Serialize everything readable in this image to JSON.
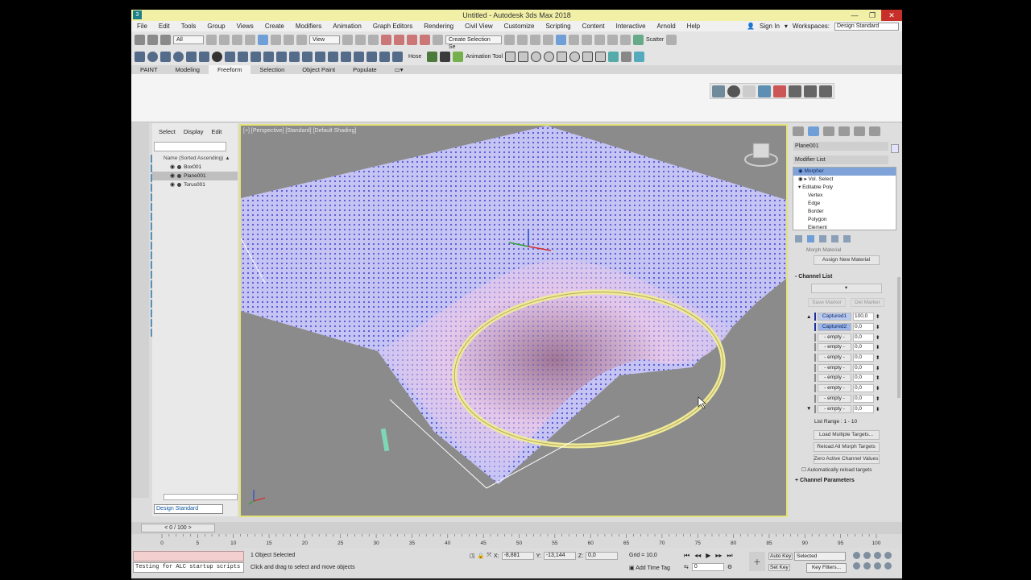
{
  "window": {
    "title": "Untitled - Autodesk 3ds Max 2018",
    "logo": "3",
    "minimize": "—",
    "maximize": "❐",
    "close": "✕"
  },
  "menu": {
    "items": [
      "File",
      "Edit",
      "Tools",
      "Group",
      "Views",
      "Create",
      "Modifiers",
      "Animation",
      "Graph Editors",
      "Rendering",
      "Civil View",
      "Customize",
      "Scripting",
      "Content",
      "Interactive",
      "Arnold",
      "Help"
    ],
    "sign_in": "Sign In",
    "workspaces_label": "Workspaces:",
    "workspace_value": "Design Standard"
  },
  "toolbar1": {
    "filter_value": "All",
    "view_value": "View",
    "selection_set": "Create Selection Se",
    "scatter": "Scatter"
  },
  "toolbar2": {
    "hose": "Hose",
    "animation_tool": "Animation Tool"
  },
  "ribbon_tabs": [
    "PAINT",
    "Modeling",
    "Freeform",
    "Selection",
    "Object Paint",
    "Populate"
  ],
  "ribbon_active": "Freeform",
  "scene_explorer": {
    "tabs": [
      "Select",
      "Display",
      "Edit"
    ],
    "column_header": "Name (Sorted Ascending)",
    "objects": [
      "Box001",
      "Plane001",
      "Torus001"
    ],
    "selected": "Plane001",
    "workspace": "Design Standard"
  },
  "viewport": {
    "label": "[+] [Perspective] [Standard] [Default Shading]"
  },
  "command_panel": {
    "object_name": "Plane001",
    "modifier_list_label": "Modifier List",
    "stack": {
      "morpher": "Morpher",
      "vol_select": "Vol. Select",
      "editable_poly": "Editable Poly",
      "subobjects": [
        "Vertex",
        "Edge",
        "Border",
        "Polygon",
        "Element"
      ]
    },
    "morph_material_label": "Morph Material",
    "assign_new_material": "Assign New Material",
    "channel_list_title": "Channel List",
    "save_marker": "Save Marker",
    "del_marker": "Del Marker",
    "channels": [
      {
        "name": "Captured1",
        "value": "100,0",
        "type": "captured"
      },
      {
        "name": "Captured2",
        "value": "0,0",
        "type": "captured-b"
      },
      {
        "name": "- empty -",
        "value": "0,0",
        "type": "empty"
      },
      {
        "name": "- empty -",
        "value": "0,0",
        "type": "empty"
      },
      {
        "name": "- empty -",
        "value": "0,0",
        "type": "empty"
      },
      {
        "name": "- empty -",
        "value": "0,0",
        "type": "empty"
      },
      {
        "name": "- empty -",
        "value": "0,0",
        "type": "empty"
      },
      {
        "name": "- empty -",
        "value": "0,0",
        "type": "empty"
      },
      {
        "name": "- empty -",
        "value": "0,0",
        "type": "empty"
      },
      {
        "name": "- empty -",
        "value": "0,0",
        "type": "empty"
      }
    ],
    "list_range_label": "List Range :",
    "list_range_value": "1 - 10",
    "load_multiple": "Load Multiple Targets...",
    "reload_all": "Reload All Morph Targets",
    "zero_active": "Zero Active Channel Values",
    "auto_reload": "Automatically reload targets",
    "channel_parameters": "Channel Parameters"
  },
  "timeline": {
    "frame_display": "0 / 100",
    "ticks": [
      "0",
      "5",
      "10",
      "15",
      "20",
      "25",
      "30",
      "35",
      "40",
      "45",
      "50",
      "55",
      "60",
      "65",
      "70",
      "75",
      "80",
      "85",
      "90",
      "95",
      "100"
    ]
  },
  "status": {
    "maxscript_output": "Testing for ALC startup scripts",
    "selection_info": "1 Object Selected",
    "prompt": "Click and drag to select and move objects",
    "x_label": "X:",
    "x_value": "-8,881",
    "y_label": "Y:",
    "y_value": "-13,144",
    "z_label": "Z:",
    "z_value": "0,0",
    "grid": "Grid = 10,0",
    "add_time_tag": "Add Time Tag",
    "current_frame": "0",
    "auto_key": "Auto Key",
    "set_key": "Set Key",
    "selected_combo": "Selected",
    "key_filters": "Key Filters..."
  },
  "colors": {
    "title_bar": "#f2f0a6",
    "viewport_bg": "#8b8b8b",
    "viewport_border": "#e3e37a",
    "selection_blue": "#7fa3d9",
    "close_red": "#c7302a"
  }
}
